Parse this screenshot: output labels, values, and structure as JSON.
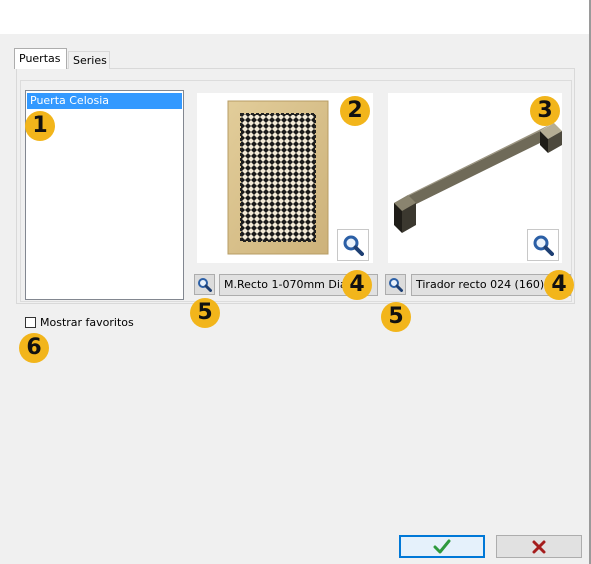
{
  "tabs": [
    {
      "label": "Puertas",
      "active": true
    },
    {
      "label": "Series",
      "active": false
    }
  ],
  "door_list": {
    "items": [
      {
        "label": "Puerta Celosia",
        "selected": true
      }
    ]
  },
  "door_model": {
    "value": "M.Recto 1-070mm Diag"
  },
  "handle_model": {
    "value": "Tirador recto 024 (160)"
  },
  "favorites": {
    "label": "Mostrar favoritos",
    "checked": false
  },
  "badges": {
    "list": "1",
    "door_preview": "2",
    "handle_preview": "3",
    "door_model": "4",
    "handle_model": "4",
    "door_search": "5",
    "handle_search": "5",
    "favorites": "6"
  },
  "colors": {
    "badge": "#f2b51b",
    "selection": "#3399ff",
    "ok_border": "#0078d7",
    "ok_check": "#2e9a3e",
    "cancel_x": "#a51d1d"
  },
  "icons": {
    "zoom": "magnifier-icon",
    "search": "magnifier-icon",
    "ok": "checkmark-icon",
    "cancel": "x-icon"
  }
}
